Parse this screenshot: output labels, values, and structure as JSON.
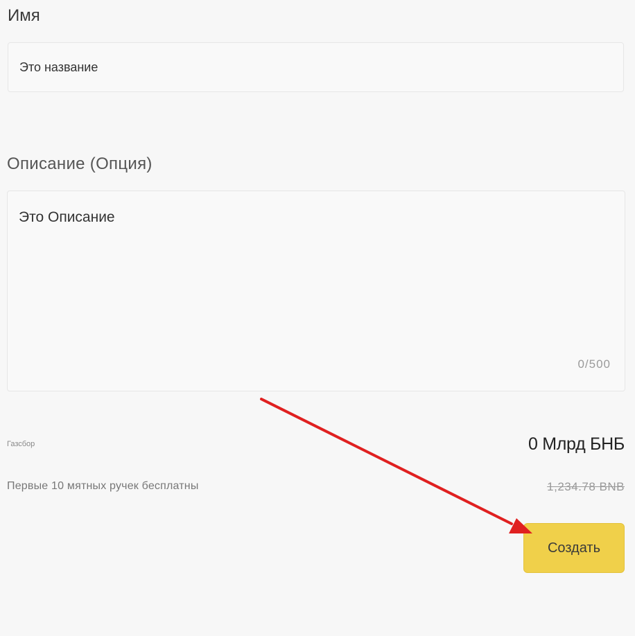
{
  "form": {
    "name_label": "Имя",
    "name_value": "Это название",
    "description_label": "Описание (Опция)",
    "description_value": "Это Описание",
    "description_counter": "0/500"
  },
  "fees": {
    "fee_label": "Газсбор",
    "fee_value": "0 Млрд БНБ",
    "free_note": "Первые 10 мятных ручек бесплатны",
    "old_price": "1,234.78 BNB"
  },
  "actions": {
    "create_label": "Создать"
  },
  "annotation": {
    "arrow_color": "#e02020"
  },
  "colors": {
    "button_bg": "#f0d04a",
    "background": "#f7f7f7"
  }
}
